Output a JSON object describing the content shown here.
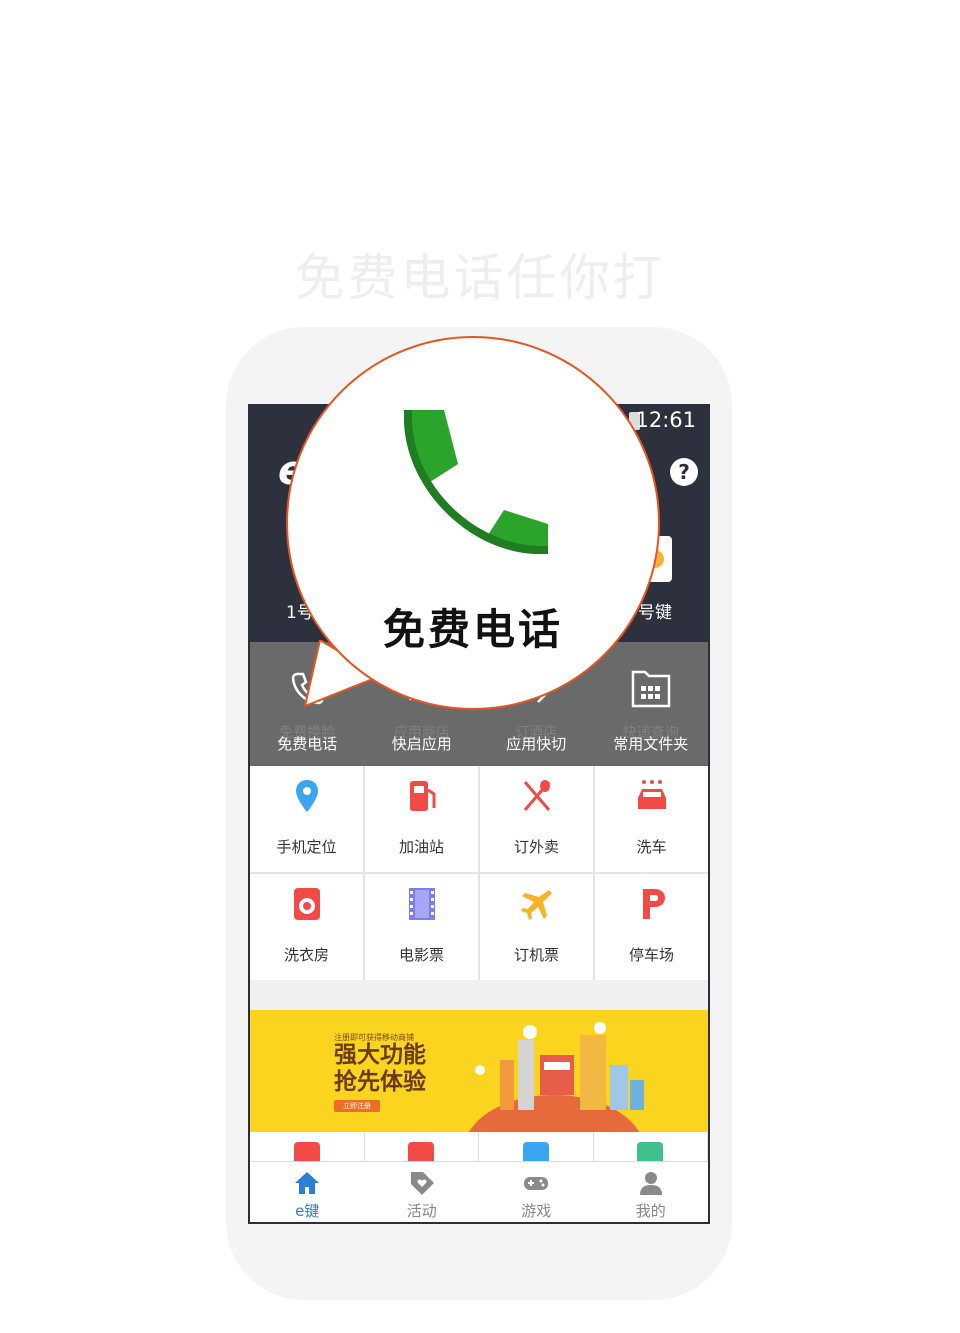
{
  "headline": "免费电话任你打",
  "status_bar": {
    "time": "12:61"
  },
  "app_bar": {
    "logo": "e",
    "help_label": "?",
    "key_left": "1号",
    "key_right": "号键"
  },
  "shortcuts": [
    {
      "ghost": "免费换脸",
      "label": "免费电话",
      "icon": "phone-icon"
    },
    {
      "ghost": "应用商店",
      "label": "快启应用",
      "icon": "rocket-icon"
    },
    {
      "ghost": "订酒店",
      "label": "应用快切",
      "icon": "switch-icon"
    },
    {
      "ghost": "快递查询",
      "label": "常用文件夹",
      "icon": "folder-icon"
    }
  ],
  "grid": [
    {
      "label": "手机定位",
      "icon": "location-pin-icon",
      "color": "#3aa6f2"
    },
    {
      "label": "加油站",
      "icon": "gas-pump-icon",
      "color": "#f24b47"
    },
    {
      "label": "订外卖",
      "icon": "fork-spoon-icon",
      "color": "#f24b47"
    },
    {
      "label": "洗车",
      "icon": "car-wash-icon",
      "color": "#f24b47"
    },
    {
      "label": "洗衣房",
      "icon": "washing-machine-icon",
      "color": "#f24b47"
    },
    {
      "label": "电影票",
      "icon": "film-icon",
      "color": "#7b7ef0"
    },
    {
      "label": "订机票",
      "icon": "airplane-icon",
      "color": "#f6b327"
    },
    {
      "label": "停车场",
      "icon": "parking-icon",
      "color": "#f24b47"
    }
  ],
  "banner": {
    "small_text": "注册即可获得移动商铺",
    "title_line1": "强大功能",
    "title_line2": "抢先体验",
    "button": "立即注册",
    "background": "#fbd41f"
  },
  "tabs": [
    {
      "label": "e键",
      "icon": "home-icon",
      "active": true
    },
    {
      "label": "活动",
      "icon": "tag-heart-icon",
      "active": false
    },
    {
      "label": "游戏",
      "icon": "gamepad-icon",
      "active": false
    },
    {
      "label": "我的",
      "icon": "person-icon",
      "active": false
    }
  ],
  "bubble": {
    "label": "免费电话",
    "icon": "phone-icon",
    "icon_color": "#2aa42a",
    "border_color": "#e8541e"
  }
}
